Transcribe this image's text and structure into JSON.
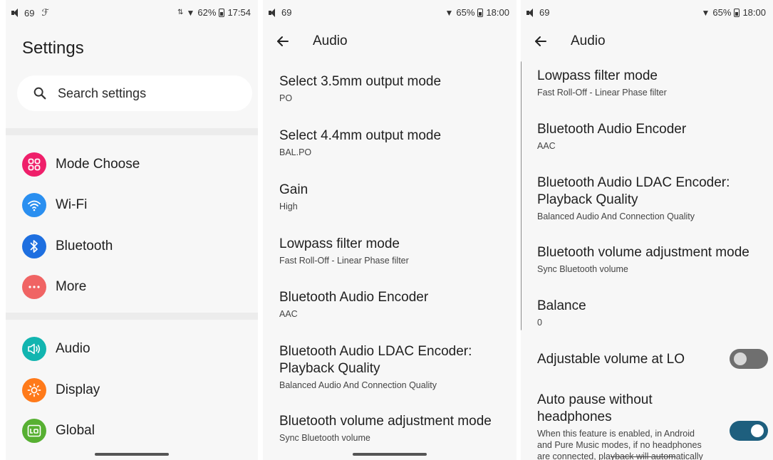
{
  "colors": {
    "mode_choose": "#ef1f6a",
    "wifi": "#2a8ff0",
    "bluetooth": "#1e6fe0",
    "more": "#f06464",
    "audio": "#12b5b0",
    "display": "#ff7a1a",
    "global": "#57b032",
    "toggle_on": "#1e5f7e"
  },
  "panel1": {
    "status": {
      "volume": "69",
      "battery": "62%",
      "time": "17:54"
    },
    "title": "Settings",
    "search": {
      "placeholder": "Search settings",
      "icon": "search-icon"
    },
    "items": [
      {
        "label": "Mode Choose",
        "icon": "grid-icon"
      },
      {
        "label": "Wi-Fi",
        "icon": "wifi-icon"
      },
      {
        "label": "Bluetooth",
        "icon": "bluetooth-icon"
      },
      {
        "label": "More",
        "icon": "more-icon"
      },
      {
        "label": "Audio",
        "icon": "speaker-icon"
      },
      {
        "label": "Display",
        "icon": "brightness-icon"
      },
      {
        "label": "Global",
        "icon": "global-icon"
      }
    ]
  },
  "panel2": {
    "status": {
      "volume": "69",
      "battery": "65%",
      "time": "18:00"
    },
    "title": "Audio",
    "items": [
      {
        "title": "Select 3.5mm output mode",
        "sub": "PO"
      },
      {
        "title": "Select 4.4mm output mode",
        "sub": "BAL.PO"
      },
      {
        "title": "Gain",
        "sub": "High"
      },
      {
        "title": "Lowpass filter mode",
        "sub": "Fast Roll-Off - Linear Phase filter"
      },
      {
        "title": "Bluetooth Audio Encoder",
        "sub": "AAC"
      },
      {
        "title_line1": "Bluetooth Audio LDAC Encoder:",
        "title_line2": "Playback Quality",
        "sub": "Balanced Audio And Connection Quality"
      },
      {
        "title": "Bluetooth volume adjustment mode",
        "sub": "Sync Bluetooth volume"
      }
    ]
  },
  "panel3": {
    "status": {
      "volume": "69",
      "battery": "65%",
      "time": "18:00"
    },
    "title": "Audio",
    "items": [
      {
        "title": "Lowpass filter mode",
        "sub": "Fast Roll-Off - Linear Phase filter"
      },
      {
        "title": "Bluetooth Audio Encoder",
        "sub": "AAC"
      },
      {
        "title_line1": "Bluetooth Audio LDAC Encoder:",
        "title_line2": "Playback Quality",
        "sub": "Balanced Audio And Connection Quality"
      },
      {
        "title": "Bluetooth volume adjustment mode",
        "sub": "Sync Bluetooth volume"
      },
      {
        "title": "Balance",
        "sub": "0"
      }
    ],
    "adjustable_lo": {
      "label": "Adjustable volume at LO",
      "on": false
    },
    "auto_pause": {
      "title_line1": "Auto pause without",
      "title_line2": "headphones",
      "desc_line1": "When this feature is enabled, in Android",
      "desc_line2": "and Pure Music modes, if no headphones",
      "desc_line3a": "are connected, pla",
      "desc_line3b": "yback will autom",
      "desc_line3c": "atically",
      "on": true
    }
  }
}
